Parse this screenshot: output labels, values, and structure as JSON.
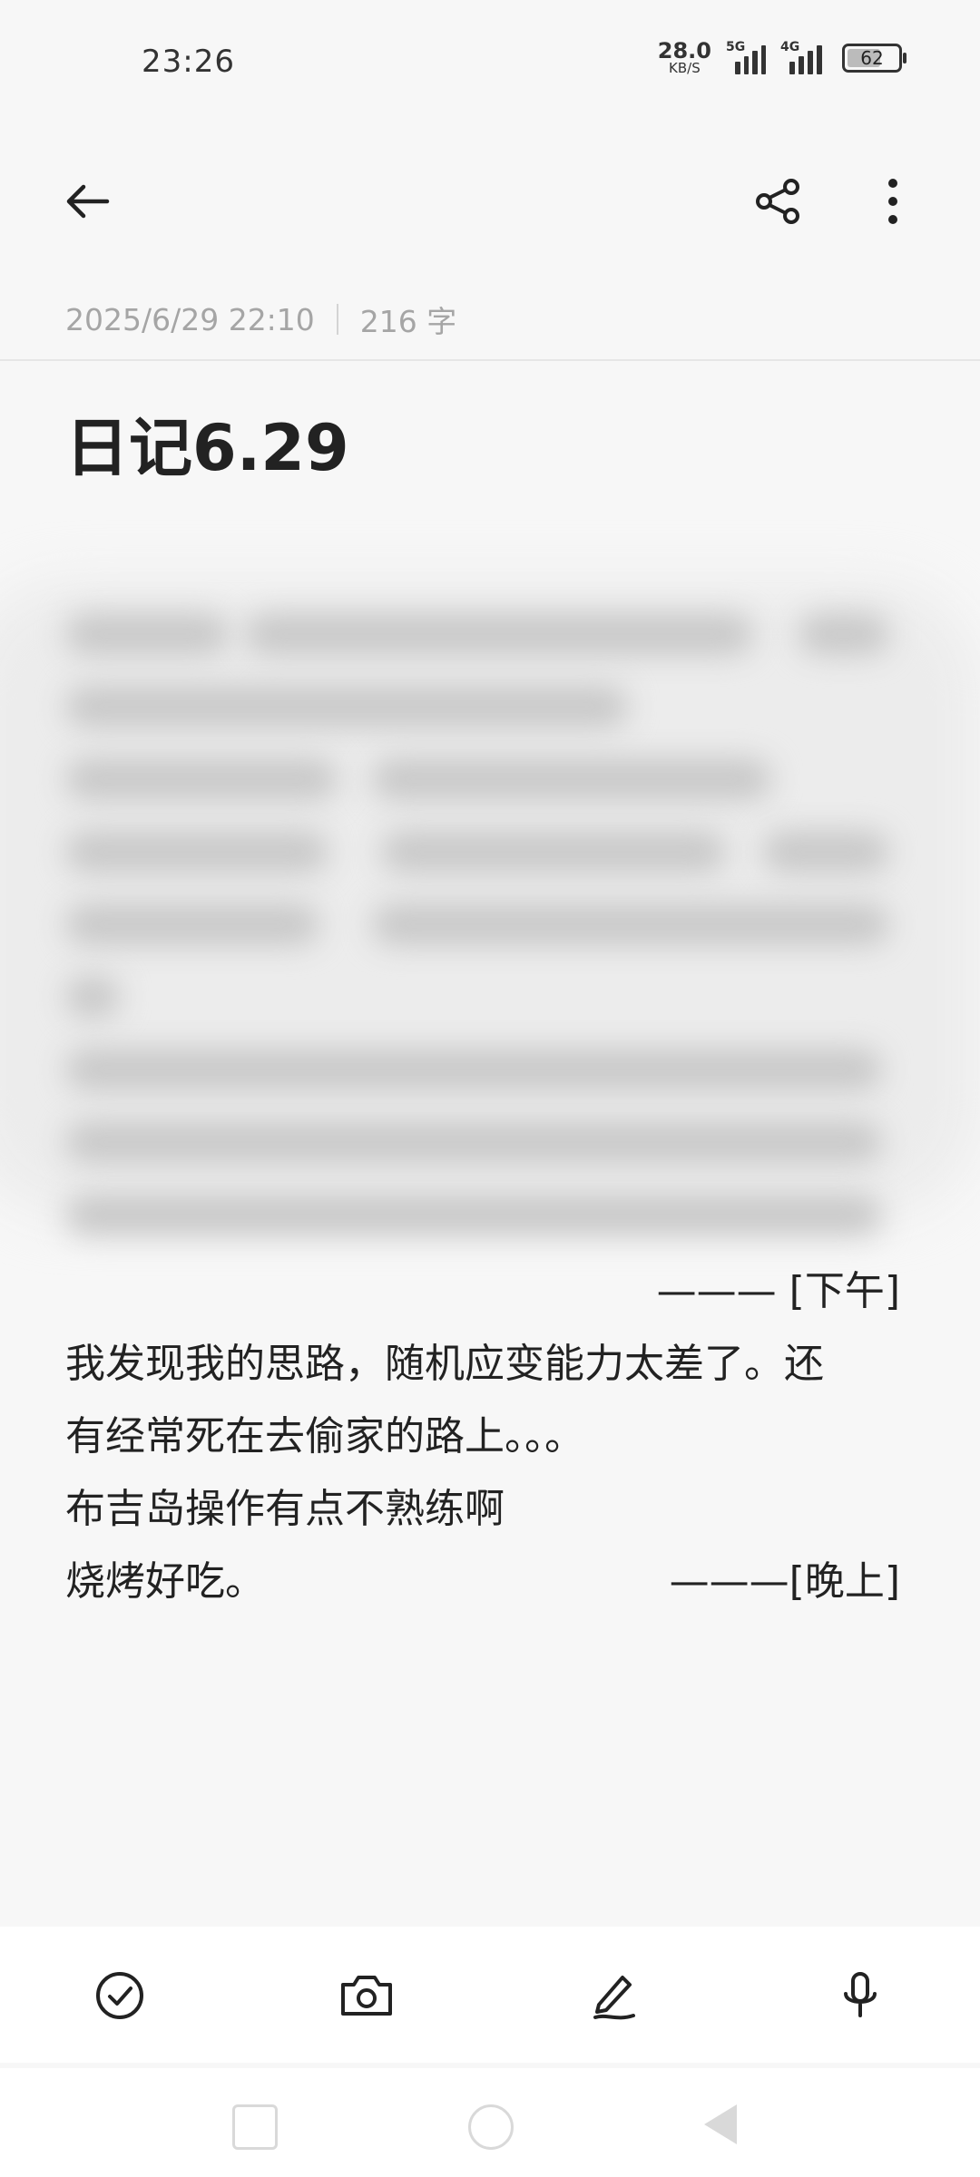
{
  "status": {
    "time": "23:26",
    "net_speed_value": "28.0",
    "net_speed_unit": "KB/S",
    "signal1_label": "5G",
    "signal2_label": "4G",
    "battery": "62"
  },
  "note": {
    "date": "2025/6/29 22:10",
    "word_count": "216 字",
    "title": "日记6.29",
    "afternoon_tag": "———  [下午]",
    "lines": [
      "我发现我的思路，随机应变能力太差了。还",
      "有经常死在去偷家的路上。。。",
      "布吉岛操作有点不熟练啊"
    ],
    "last_line_text": "烧烤好吃。",
    "evening_tag": "———[晚上]"
  },
  "icons": {
    "back": "back-arrow-icon",
    "share": "share-icon",
    "more": "more-vertical-icon",
    "check": "checklist-icon",
    "camera": "camera-icon",
    "pen": "handwriting-pen-icon",
    "mic": "microphone-icon"
  }
}
